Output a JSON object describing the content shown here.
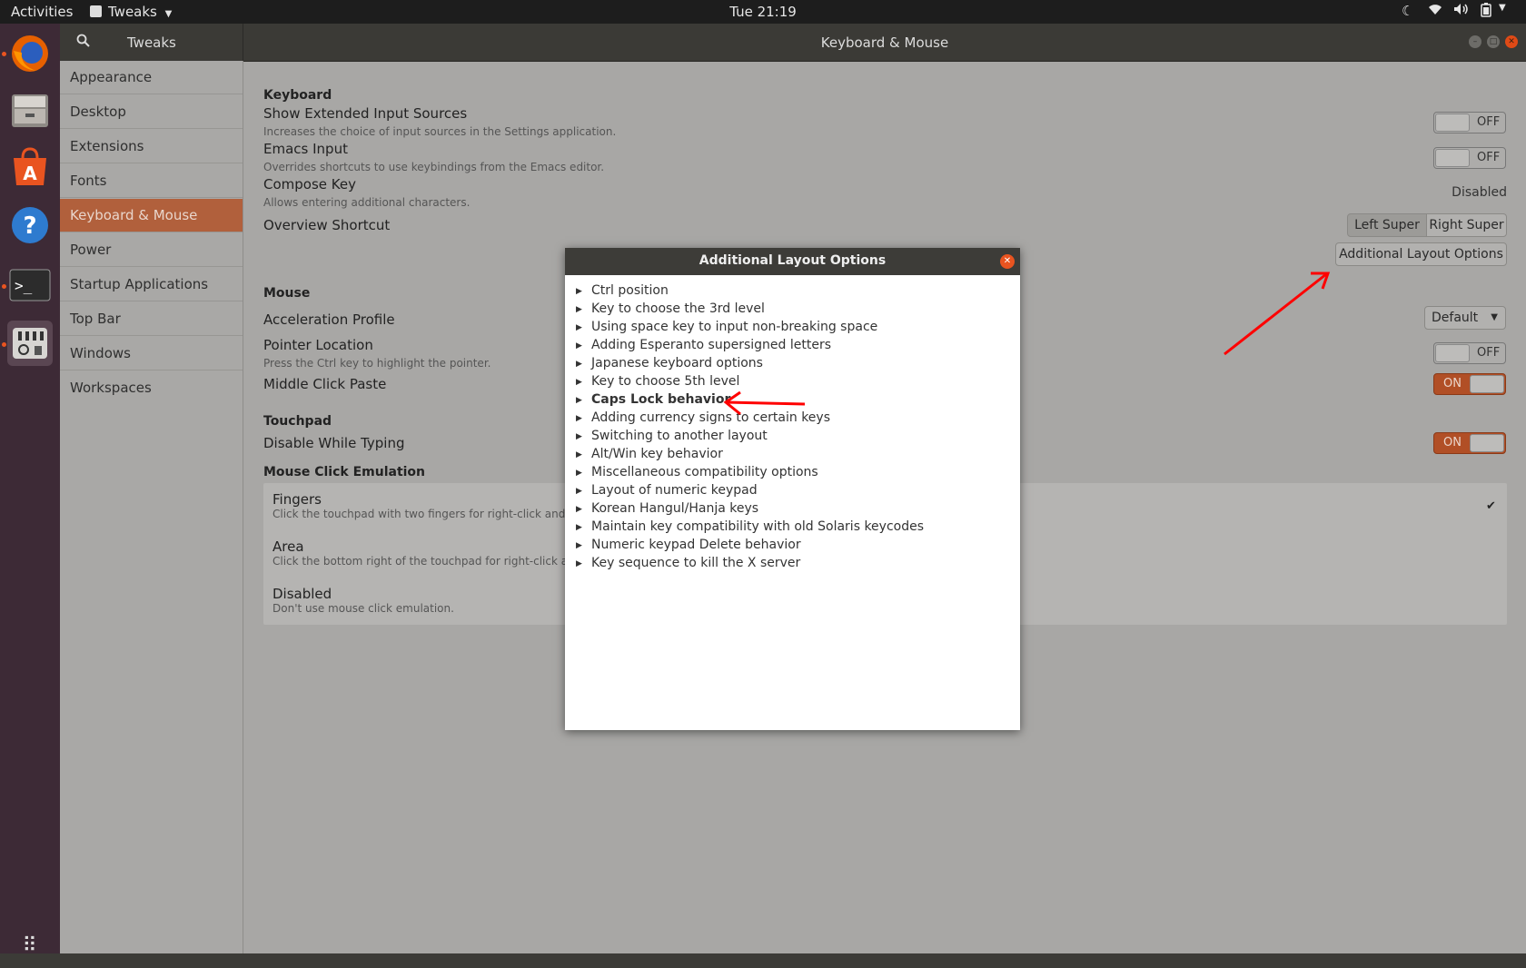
{
  "topbar": {
    "activities": "Activities",
    "app_menu": "Tweaks",
    "clock": "Tue 21:19"
  },
  "window": {
    "sidebar_title": "Tweaks",
    "title": "Keyboard & Mouse"
  },
  "sidebar": {
    "items": [
      {
        "label": "Appearance"
      },
      {
        "label": "Desktop"
      },
      {
        "label": "Extensions"
      },
      {
        "label": "Fonts"
      },
      {
        "label": "Keyboard & Mouse"
      },
      {
        "label": "Power"
      },
      {
        "label": "Startup Applications"
      },
      {
        "label": "Top Bar"
      },
      {
        "label": "Windows"
      },
      {
        "label": "Workspaces"
      }
    ]
  },
  "keyboard": {
    "heading": "Keyboard",
    "extended_title": "Show Extended Input Sources",
    "extended_desc": "Increases the choice of input sources in the Settings application.",
    "extended_state": "OFF",
    "emacs_title": "Emacs Input",
    "emacs_desc": "Overrides shortcuts to use keybindings from the Emacs editor.",
    "emacs_state": "OFF",
    "compose_title": "Compose Key",
    "compose_desc": "Allows entering additional characters.",
    "compose_value": "Disabled",
    "overview_title": "Overview Shortcut",
    "left_super": "Left Super",
    "right_super": "Right Super",
    "additional_layout_button": "Additional Layout Options"
  },
  "mouse": {
    "heading": "Mouse",
    "accel_title": "Acceleration Profile",
    "accel_value": "Default",
    "pointer_title": "Pointer Location",
    "pointer_desc": "Press the Ctrl key to highlight the pointer.",
    "pointer_state": "OFF",
    "middle_title": "Middle Click Paste",
    "middle_state": "ON"
  },
  "touchpad": {
    "heading": "Touchpad",
    "dwt_title": "Disable While Typing",
    "dwt_state": "ON",
    "emulation_heading": "Mouse Click Emulation",
    "fingers_title": "Fingers",
    "fingers_desc": "Click the touchpad with two fingers for right-click and thre",
    "area_title": "Area",
    "area_desc": "Click the bottom right of the touchpad for right-click and t",
    "disabled_title": "Disabled",
    "disabled_desc": "Don't use mouse click emulation.",
    "check": "✔"
  },
  "dialog": {
    "title": "Additional Layout Options",
    "options": [
      {
        "label": "Ctrl position"
      },
      {
        "label": "Key to choose the 3rd level"
      },
      {
        "label": "Using space key to input non-breaking space"
      },
      {
        "label": "Adding Esperanto supersigned letters"
      },
      {
        "label": "Japanese keyboard options"
      },
      {
        "label": "Key to choose 5th level"
      },
      {
        "label": "Caps Lock behavior"
      },
      {
        "label": "Adding currency signs to certain keys"
      },
      {
        "label": "Switching to another layout"
      },
      {
        "label": "Alt/Win key behavior"
      },
      {
        "label": "Miscellaneous compatibility options"
      },
      {
        "label": "Layout of numeric keypad"
      },
      {
        "label": "Korean Hangul/Hanja keys"
      },
      {
        "label": "Maintain key compatibility with old Solaris keycodes"
      },
      {
        "label": "Numeric keypad Delete behavior"
      },
      {
        "label": "Key sequence to kill the X server"
      }
    ]
  },
  "colors": {
    "accent": "#e95420",
    "selected_sidebar": "#b1603c",
    "annotation": "#ff0000"
  }
}
